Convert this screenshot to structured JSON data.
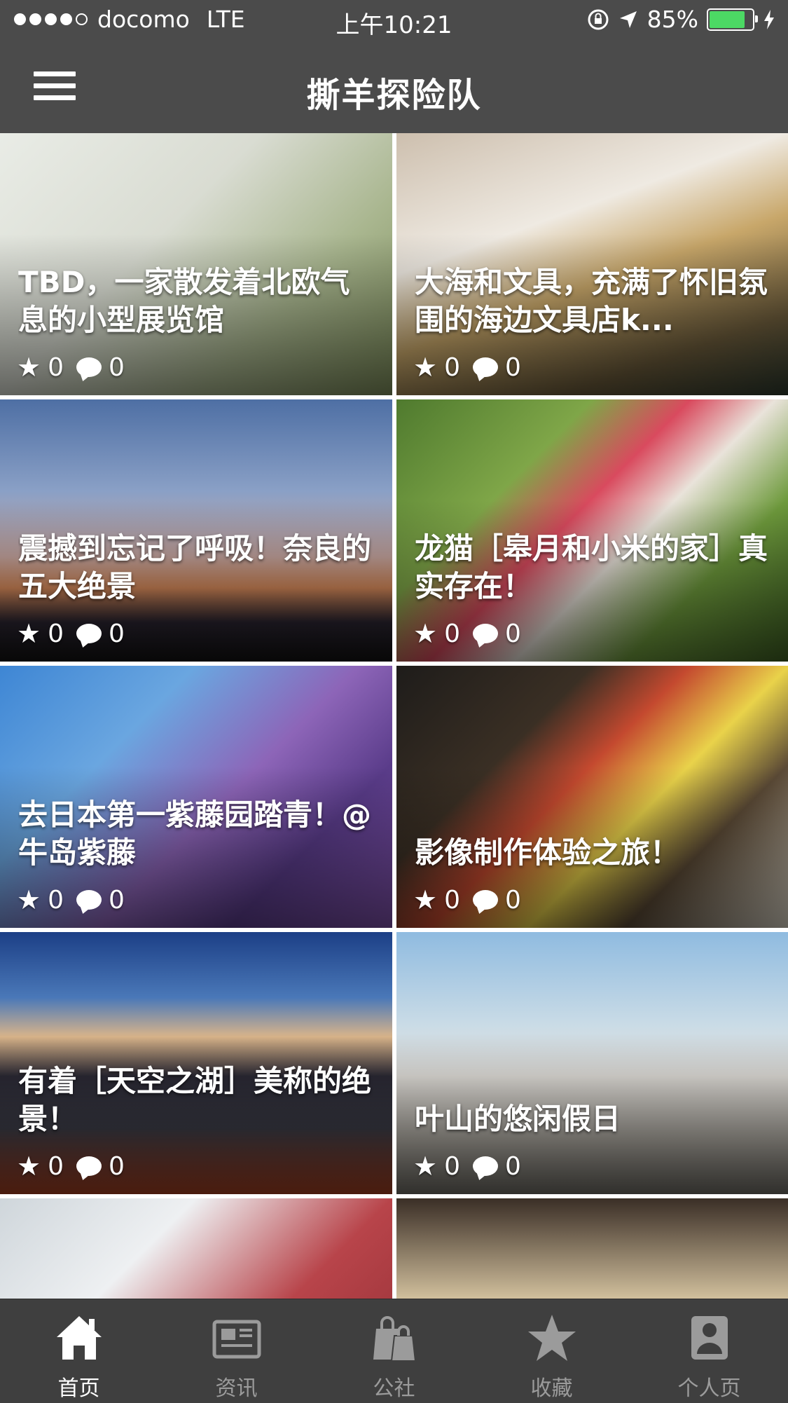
{
  "status_bar": {
    "carrier": "docomo",
    "network": "LTE",
    "time": "上午10:21",
    "battery_percent": "85%",
    "battery_level": 0.85
  },
  "nav": {
    "title": "撕羊探险队",
    "menu_icon": "hamburger-menu-icon"
  },
  "cards": [
    {
      "title": "TBD，一家散发着北欧气息的小型展览馆",
      "stars": "0",
      "comments": "0"
    },
    {
      "title": "大海和文具，充满了怀旧氛围的海边文具店k...",
      "stars": "0",
      "comments": "0"
    },
    {
      "title": "震撼到忘记了呼吸！奈良的五大绝景",
      "stars": "0",
      "comments": "0"
    },
    {
      "title": "龙猫［皋月和小米的家］真实存在！",
      "stars": "0",
      "comments": "0"
    },
    {
      "title": "去日本第一紫藤园踏青！@牛岛紫藤",
      "stars": "0",
      "comments": "0"
    },
    {
      "title": "影像制作体验之旅！",
      "stars": "0",
      "comments": "0"
    },
    {
      "title": "有着［天空之湖］美称的绝景！",
      "stars": "0",
      "comments": "0"
    },
    {
      "title": "叶山的悠闲假日",
      "stars": "0",
      "comments": "0"
    },
    {
      "title": "",
      "stars": "",
      "comments": ""
    },
    {
      "title": "",
      "stars": "",
      "comments": ""
    }
  ],
  "tabs": [
    {
      "label": "首页",
      "icon": "home-icon",
      "active": true
    },
    {
      "label": "资讯",
      "icon": "newspaper-icon",
      "active": false
    },
    {
      "label": "公社",
      "icon": "shopping-bag-icon",
      "active": false
    },
    {
      "label": "收藏",
      "icon": "star-icon",
      "active": false
    },
    {
      "label": "个人页",
      "icon": "person-icon",
      "active": false
    }
  ],
  "colors": {
    "bar_background": "#4b4b4b",
    "tabbar_background": "#3f3f3f",
    "tab_inactive": "#9b9b9b",
    "tab_active": "#ffffff",
    "battery_green": "#4cd964"
  }
}
